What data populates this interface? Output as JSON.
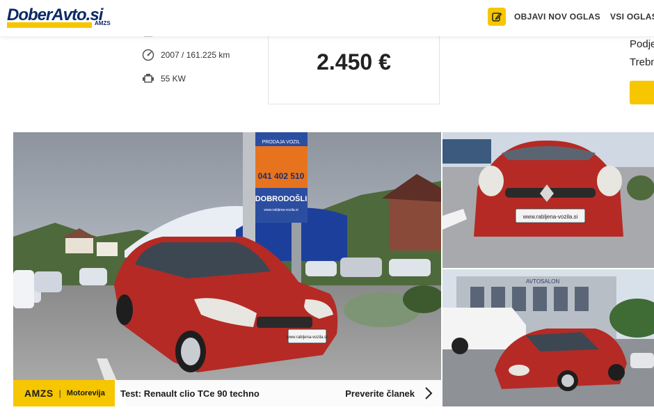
{
  "header": {
    "logo_text": "DoberAvto.si",
    "logo_sub": "AMZS",
    "publish_label": "OBJAVI NOV OGLAS",
    "all_label": "VSI OGLASI"
  },
  "specs": {
    "year_mileage": "2007 / 161.225 km",
    "power": "55 KW"
  },
  "price": "2.450 €",
  "right_column": {
    "line1": "Podje",
    "line2": "Trebn"
  },
  "gallery": {
    "sign_phone": "041 402 510",
    "sign_welcome": "DOBRODOŠLI",
    "sign_url": "www.rabljena-vozila.si",
    "sign_top": "PRODAJA VOZIL",
    "plate_text": "www.rabljena-vozila.si",
    "building_text": "AVTOSALON"
  },
  "banner": {
    "brand": "AMZS",
    "separator": "|",
    "section": "Motorevija",
    "title": "Test: Renault clio TCe 90 techno",
    "link": "Preverite članek"
  },
  "colors": {
    "accent": "#f6c600",
    "brand_blue": "#0a2a66",
    "car_red": "#b52a25"
  }
}
